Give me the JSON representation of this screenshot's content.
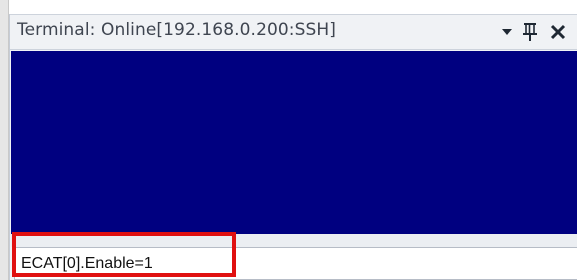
{
  "window": {
    "title": "Terminal: Online[192.168.0.200:SSH]"
  },
  "titlebar_buttons": {
    "dropdown_icon": "chevron-down-icon",
    "pin_icon": "pin-icon",
    "close_icon": "close-icon"
  },
  "terminal": {
    "background_color": "#000080",
    "output_text": ""
  },
  "command_input": {
    "value": "ECAT[0].Enable=1"
  },
  "annotation": {
    "highlight_color": "#e01010"
  }
}
